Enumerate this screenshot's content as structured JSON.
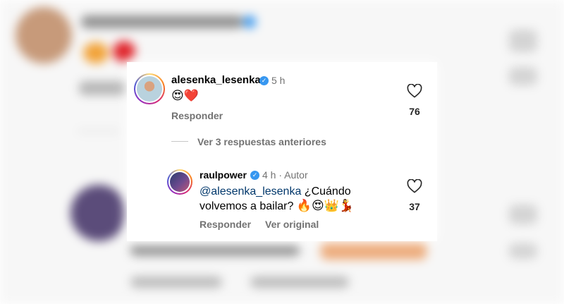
{
  "comment": {
    "username": "alesenka_lesenka",
    "time": "5 h",
    "emojis": "😍❤️",
    "reply_label": "Responder",
    "likes": "76"
  },
  "view_replies": "Ver 3 respuestas anteriores",
  "reply": {
    "username": "raulpower",
    "time": "4 h",
    "separator": "·",
    "author_tag": "Autor",
    "mention": "@alesenka_lesenka",
    "text_line1": " ¿Cuándo",
    "text_line2": "volvemos a bailar?",
    "emojis": "🔥😍👑💃",
    "reply_label": "Responder",
    "see_original_label": "Ver original",
    "likes": "37"
  },
  "colors": {
    "verified": "#3797f0",
    "mention": "#00376b",
    "secondary_text": "#737373"
  }
}
